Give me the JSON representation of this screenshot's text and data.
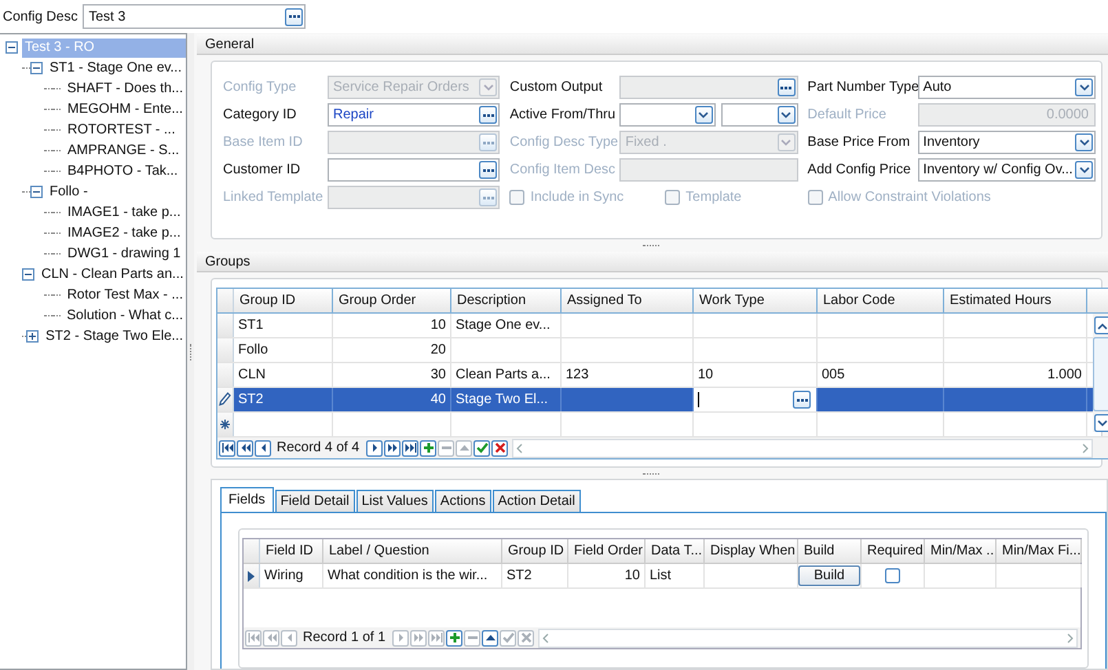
{
  "config_desc": {
    "label": "Config Desc",
    "value": "Test 3"
  },
  "tree": [
    {
      "label": "Test 3 - RO",
      "selected": true,
      "expanded": true,
      "children": [
        {
          "label": "ST1 - Stage One ev...",
          "selected": false,
          "expanded": true,
          "children": [
            {
              "label": "SHAFT - Does th...",
              "selected": false
            },
            {
              "label": "MEGOHM - Ente...",
              "selected": false
            },
            {
              "label": "ROTORTEST - ...",
              "selected": false
            },
            {
              "label": "AMPRANGE - S...",
              "selected": false
            },
            {
              "label": "B4PHOTO - Tak...",
              "selected": false
            }
          ]
        },
        {
          "label": "Follo -",
          "selected": false,
          "expanded": true,
          "children": [
            {
              "label": "IMAGE1 - take p...",
              "selected": false
            },
            {
              "label": "IMAGE2 - take p...",
              "selected": false
            },
            {
              "label": "DWG1 - drawing 1",
              "selected": false
            }
          ]
        },
        {
          "label": "CLN - Clean Parts an...",
          "selected": false,
          "expanded": true,
          "children": [
            {
              "label": "Rotor Test Max - ...",
              "selected": false
            },
            {
              "label": "Solution - What c...",
              "selected": false
            }
          ]
        },
        {
          "label": "ST2 - Stage Two Ele...",
          "selected": false,
          "expanded": false
        }
      ]
    }
  ],
  "general": {
    "title": "General",
    "columns": [
      [
        {
          "kind": "combo",
          "label": "Config Type",
          "value": "Service Repair Orders",
          "disabled": true
        },
        {
          "kind": "lookup",
          "label": "Category ID",
          "value": "Repair",
          "disabled": false
        },
        {
          "kind": "lookup",
          "label": "Base Item ID",
          "disabled": true
        },
        {
          "kind": "lookup",
          "label": "Customer ID",
          "disabled": false
        },
        {
          "kind": "lookup",
          "label": "Linked Template",
          "disabled": true
        }
      ],
      [
        {
          "kind": "lookup",
          "label": "Custom Output",
          "disabled": false,
          "readonly": true
        },
        {
          "kind": "dates",
          "label": "Active From/Thru",
          "disabled": false
        },
        {
          "kind": "combo",
          "label": "Config Desc Type",
          "value": "Fixed .",
          "disabled": true
        },
        {
          "kind": "text",
          "label": "Config Item Desc",
          "disabled": true
        },
        {
          "kind": "checks",
          "items": [
            {
              "label": "Include in Sync",
              "checked": false,
              "disabled": true
            },
            {
              "label": "Template",
              "checked": false,
              "disabled": true
            }
          ]
        }
      ],
      [
        {
          "kind": "combo",
          "label": "Part Number Type",
          "value": "Auto",
          "disabled": false
        },
        {
          "kind": "number",
          "label": "Default Price",
          "value": "0.0000",
          "disabled": true
        },
        {
          "kind": "combo",
          "label": "Base Price From",
          "value": "Inventory",
          "disabled": false
        },
        {
          "kind": "combo",
          "label": "Add Config Price",
          "value": "Inventory w/ Config Ov...",
          "disabled": false
        },
        {
          "kind": "checks",
          "items": [
            {
              "label": "Allow Constraint Violations",
              "checked": false,
              "disabled": true
            }
          ]
        }
      ]
    ]
  },
  "groups": {
    "title": "Groups",
    "columns": [
      {
        "label": "Group ID",
        "numeric": false,
        "lookup": false
      },
      {
        "label": "Group Order",
        "numeric": true,
        "lookup": false
      },
      {
        "label": "Description",
        "numeric": false,
        "lookup": false
      },
      {
        "label": "Assigned To",
        "numeric": false,
        "lookup": false
      },
      {
        "label": "Work Type",
        "numeric": false,
        "lookup": true
      },
      {
        "label": "Labor Code",
        "numeric": false,
        "lookup": false
      },
      {
        "label": "Estimated Hours",
        "numeric": true,
        "lookup": false
      }
    ],
    "rows": [
      {
        "selected": false,
        "editing": false,
        "cells": [
          "ST1",
          "10",
          "Stage One ev...",
          "",
          "",
          "",
          ""
        ]
      },
      {
        "selected": false,
        "editing": false,
        "cells": [
          "Follo",
          "20",
          "",
          "",
          "",
          "",
          ""
        ]
      },
      {
        "selected": false,
        "editing": false,
        "cells": [
          "CLN",
          "30",
          "Clean Parts a...",
          "123",
          "10",
          "005",
          "1.000"
        ]
      },
      {
        "selected": true,
        "editing": true,
        "cells": [
          "ST2",
          "40",
          "Stage Two El...",
          "",
          "",
          "",
          ""
        ]
      }
    ],
    "new_row": true,
    "navigator": {
      "record": "Record 4 of 4",
      "buttons": [
        {
          "kind": "first",
          "disabled": false
        },
        {
          "kind": "prev-page",
          "disabled": false
        },
        {
          "kind": "prev",
          "disabled": false
        },
        {
          "kind": "next",
          "disabled": false
        },
        {
          "kind": "next-page",
          "disabled": false
        },
        {
          "kind": "last",
          "disabled": false
        },
        {
          "kind": "add",
          "disabled": false
        },
        {
          "kind": "delete",
          "disabled": true
        },
        {
          "kind": "up",
          "disabled": true
        },
        {
          "kind": "accept",
          "disabled": false
        },
        {
          "kind": "cancel",
          "disabled": false
        }
      ]
    }
  },
  "tabs": [
    {
      "label": "Fields",
      "selected": true
    },
    {
      "label": "Field Detail",
      "selected": false
    },
    {
      "label": "List Values",
      "selected": false
    },
    {
      "label": "Actions",
      "selected": false
    },
    {
      "label": "Action Detail",
      "selected": false
    }
  ],
  "fields": {
    "columns": [
      {
        "label": "Field ID",
        "kind": "text"
      },
      {
        "label": "Label / Question",
        "kind": "text"
      },
      {
        "label": "Group ID",
        "kind": "text"
      },
      {
        "label": "Field Order",
        "kind": "number"
      },
      {
        "label": "Data T...",
        "kind": "text"
      },
      {
        "label": "Display When",
        "kind": "text"
      },
      {
        "label": "Build",
        "kind": "button"
      },
      {
        "label": "Required",
        "kind": "checkbox"
      },
      {
        "label": "Min/Max ...",
        "kind": "text"
      },
      {
        "label": "Min/Max Fi...",
        "kind": "text"
      }
    ],
    "rows": [
      {
        "current": true,
        "cells": [
          "Wiring",
          "What condition is the wir...",
          "ST2",
          "10",
          "List",
          "",
          "Build",
          false,
          "",
          ""
        ]
      }
    ],
    "navigator": {
      "record": "Record 1 of 1",
      "buttons": [
        {
          "kind": "first",
          "disabled": true
        },
        {
          "kind": "prev-page",
          "disabled": true
        },
        {
          "kind": "prev",
          "disabled": true
        },
        {
          "kind": "next",
          "disabled": true
        },
        {
          "kind": "next-page",
          "disabled": true
        },
        {
          "kind": "last",
          "disabled": true
        },
        {
          "kind": "add",
          "disabled": false
        },
        {
          "kind": "delete",
          "disabled": true
        },
        {
          "kind": "up",
          "disabled": false
        },
        {
          "kind": "accept",
          "disabled": true
        },
        {
          "kind": "cancel",
          "disabled": true
        }
      ]
    }
  }
}
